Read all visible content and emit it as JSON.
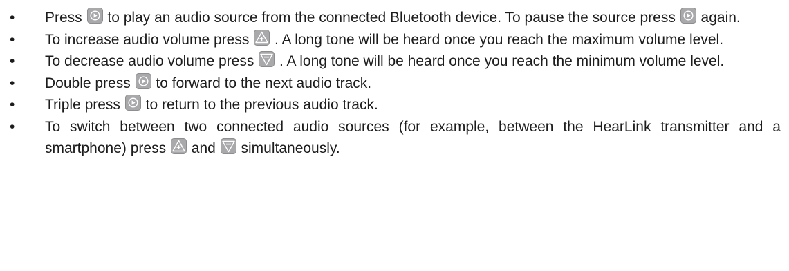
{
  "bullets": [
    {
      "parts": [
        "Press",
        "to play an audio source from the connected Bluetooth device. To pause the source press",
        "again."
      ],
      "icons": [
        "play-icon",
        "play-icon"
      ]
    },
    {
      "parts": [
        "To increase audio volume press",
        ". A long tone will be heard once you reach the maximum volume level."
      ],
      "icons": [
        "volume-up-icon"
      ]
    },
    {
      "parts": [
        "To decrease audio volume press",
        ". A long tone will be heard once you reach the minimum volume level."
      ],
      "icons": [
        "volume-down-icon"
      ]
    },
    {
      "parts": [
        "Double press",
        "to forward to the next audio track."
      ],
      "icons": [
        "play-icon"
      ]
    },
    {
      "parts": [
        "Triple press",
        "to return to the previous audio track."
      ],
      "icons": [
        "play-icon"
      ]
    },
    {
      "parts": [
        "To switch between two connected audio sources (for example, between the HearLink transmitter and a smartphone) press",
        "and",
        "simultaneously."
      ],
      "icons": [
        "volume-up-icon",
        "volume-down-icon"
      ]
    }
  ],
  "bullet_symbol": "•",
  "colors": {
    "icon_fill": "#a9a9ab",
    "icon_border": "#8e8e91",
    "icon_symbol": "#ffffff",
    "text": "#1c1c1c"
  }
}
